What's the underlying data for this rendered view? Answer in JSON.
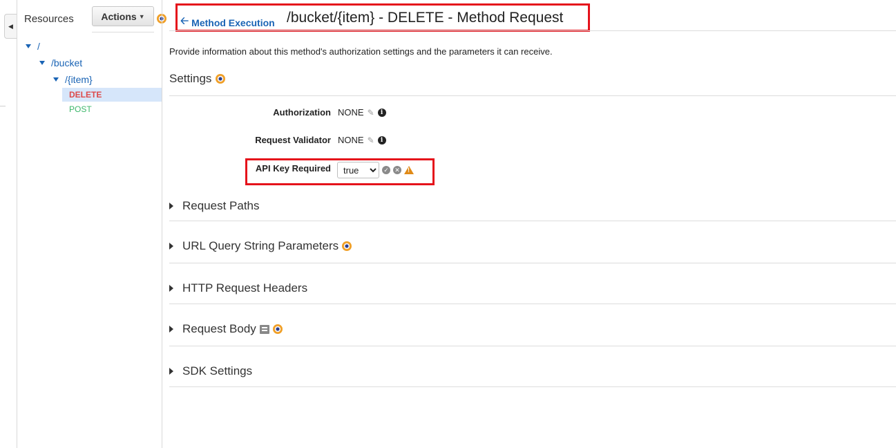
{
  "resources_panel": {
    "title": "Resources",
    "actions_label": "Actions",
    "tree": [
      {
        "label": "/"
      },
      {
        "label": "/bucket"
      },
      {
        "label": "/{item}"
      }
    ],
    "methods": [
      {
        "label": "DELETE",
        "selected": true,
        "color": "#dd4a4a"
      },
      {
        "label": "POST",
        "selected": false,
        "color": "#3cb76a"
      }
    ]
  },
  "header": {
    "back_link": "Method Execution",
    "title": "/bucket/{item} - DELETE - Method Request"
  },
  "description": "Provide information about this method's authorization settings and the parameters it can receive.",
  "settings": {
    "title": "Settings",
    "fields": {
      "authorization": {
        "label": "Authorization",
        "value": "NONE"
      },
      "request_validator": {
        "label": "Request Validator",
        "value": "NONE"
      },
      "api_key_required": {
        "label": "API Key Required",
        "selected": "true",
        "options": [
          "true",
          "false"
        ]
      }
    }
  },
  "sections": [
    {
      "label": "Request Paths"
    },
    {
      "label": "URL Query String Parameters"
    },
    {
      "label": "HTTP Request Headers"
    },
    {
      "label": "Request Body"
    },
    {
      "label": "SDK Settings"
    }
  ],
  "colors": {
    "link": "#1a64b5",
    "highlight_border": "#e5121b",
    "selected_row": "#d6e6fa",
    "warning": "#e08a17"
  }
}
